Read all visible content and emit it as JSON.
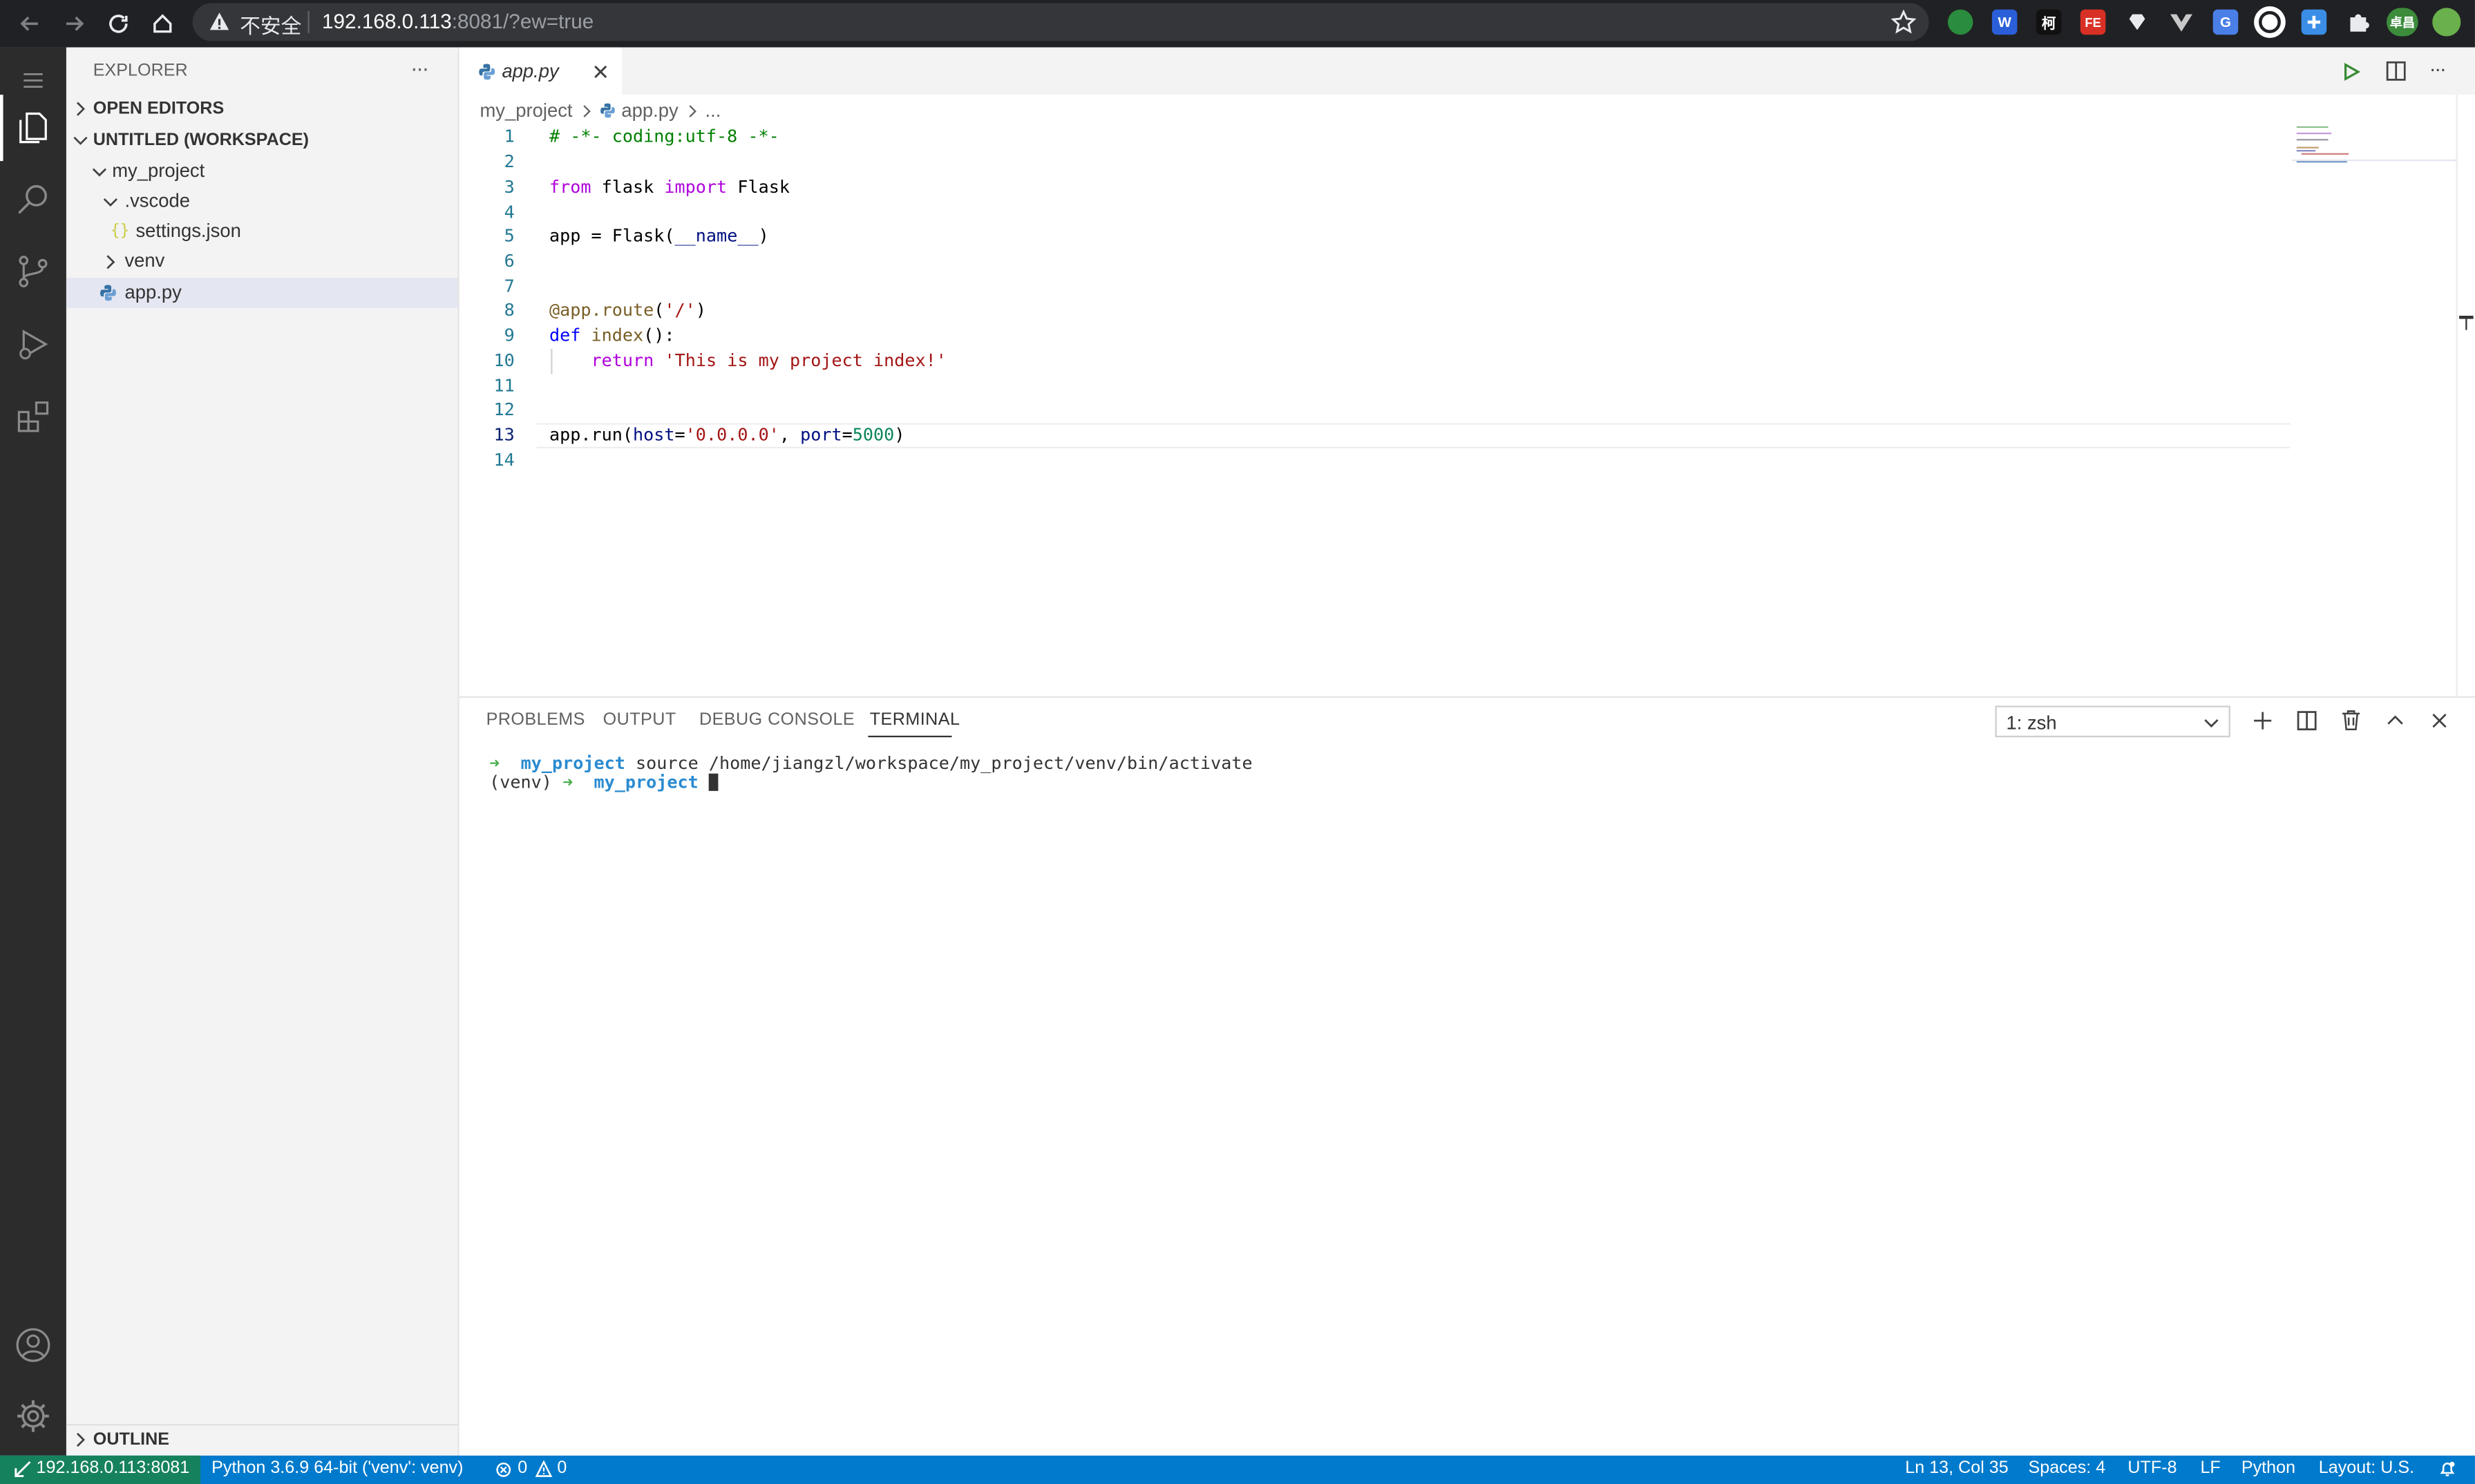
{
  "browser": {
    "insecure_label": "不安全",
    "url_host": "192.168.0.113",
    "url_rest": ":8081/?ew=true",
    "extensions": [
      "W",
      "柯",
      "FE",
      "G",
      "卓昌"
    ]
  },
  "sidebar": {
    "title": "EXPLORER",
    "more": "···",
    "open_editors": "OPEN EDITORS",
    "workspace": "UNTITLED (WORKSPACE)",
    "tree": [
      {
        "label": "my_project"
      },
      {
        "label": ".vscode"
      },
      {
        "label": "settings.json",
        "icon": "{}"
      },
      {
        "label": "venv"
      },
      {
        "label": "app.py"
      }
    ],
    "outline": "OUTLINE"
  },
  "editor": {
    "tab_label": "app.py",
    "breadcrumb": [
      "my_project",
      "app.py",
      "..."
    ],
    "lines": [
      {
        "n": "1",
        "text": "# -*- coding:utf-8 -*-"
      },
      {
        "n": "2",
        "text": ""
      },
      {
        "n": "3",
        "text": "from flask import Flask"
      },
      {
        "n": "4",
        "text": ""
      },
      {
        "n": "5",
        "text": "app = Flask(__name__)"
      },
      {
        "n": "6",
        "text": ""
      },
      {
        "n": "7",
        "text": ""
      },
      {
        "n": "8",
        "text": "@app.route('/')"
      },
      {
        "n": "9",
        "text": "def index():"
      },
      {
        "n": "10",
        "text": "    return 'This is my project index!'"
      },
      {
        "n": "11",
        "text": ""
      },
      {
        "n": "12",
        "text": ""
      },
      {
        "n": "13",
        "text": "app.run(host='0.0.0.0', port=5000)"
      },
      {
        "n": "14",
        "text": ""
      }
    ]
  },
  "panel": {
    "tabs": [
      "PROBLEMS",
      "OUTPUT",
      "DEBUG CONSOLE",
      "TERMINAL"
    ],
    "active_tab": "TERMINAL",
    "terminal_select": "1: zsh",
    "terminal": {
      "arrow": "➜",
      "dir": "my_project",
      "cmd": "source /home/jiangzl/workspace/my_project/venv/bin/activate",
      "venv": "(venv)"
    }
  },
  "status": {
    "remote": "192.168.0.113:8081",
    "interpreter": "Python 3.6.9 64-bit ('venv': venv)",
    "errors": "0",
    "warnings": "0",
    "position": "Ln 13, Col 35",
    "spaces": "Spaces: 4",
    "encoding": "UTF-8",
    "eol": "LF",
    "language": "Python",
    "layout": "Layout: U.S."
  },
  "colors": {
    "status_bar": "#007acc",
    "activity_bar": "#2c2c2c",
    "keyword": "#af00db",
    "string": "#a31515",
    "comment": "#008000"
  }
}
